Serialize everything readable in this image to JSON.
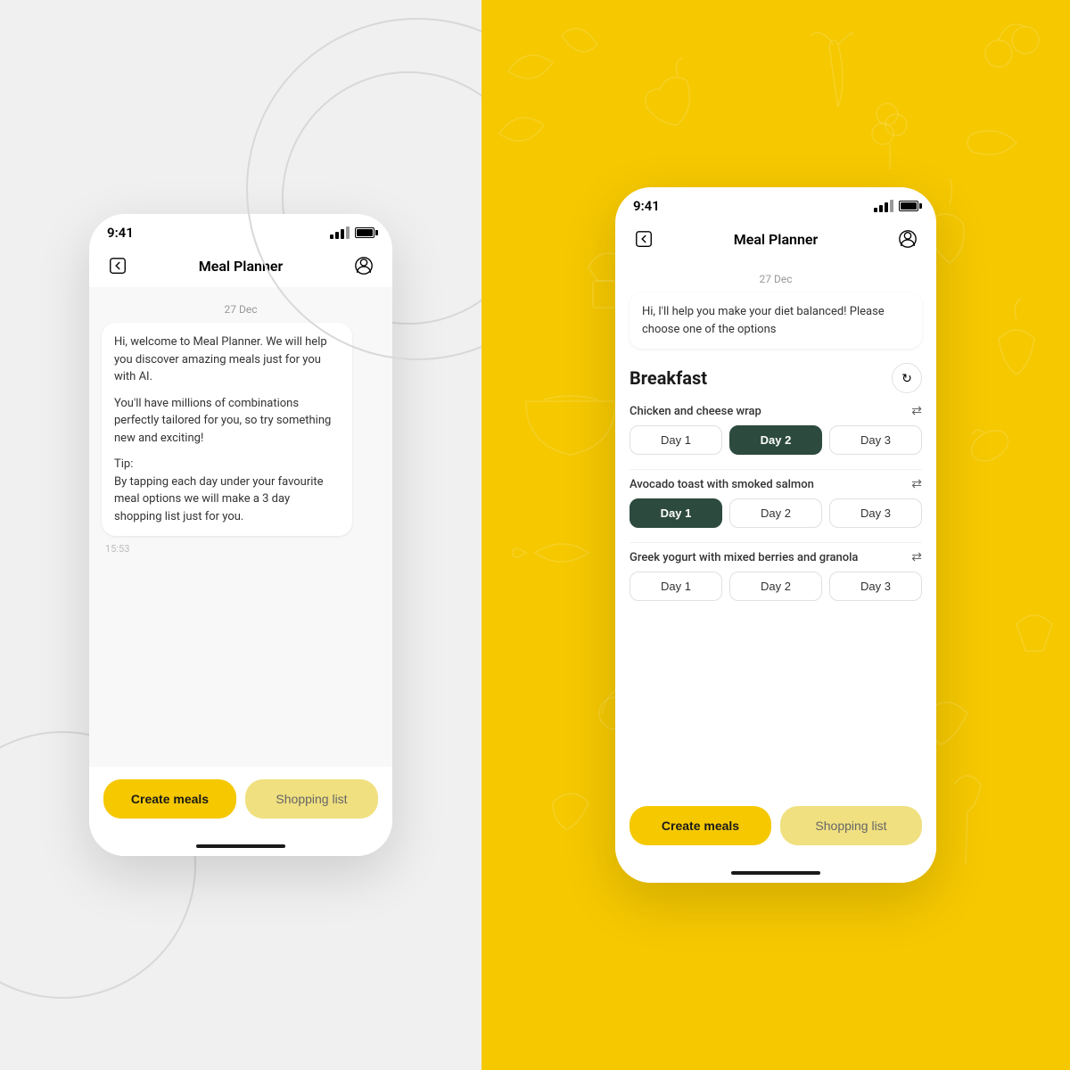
{
  "left": {
    "phone": {
      "status_bar": {
        "time": "9:41",
        "signal": "●●●",
        "battery": "■"
      },
      "nav": {
        "title": "Meal Planner"
      },
      "date_divider": "27 Dec",
      "chat_bubble": {
        "line1": "Hi, welcome to Meal Planner. We",
        "line2": "will help you discover amazing meals just for you",
        "line3": "with AI.",
        "line4": "You'll have millions of combinations perfectly",
        "line5": "tailored for you, so try something new and exciting!",
        "line6": "Tip:",
        "line7": "By tapping each day under your favourite meal",
        "line8": "options we will make a 3 day shopping list just for",
        "line9": "you."
      },
      "timestamp": "15:53",
      "btn_primary": "Create meals",
      "btn_secondary": "Shopping list"
    }
  },
  "right": {
    "phone": {
      "status_bar": {
        "time": "9:41",
        "signal": "●●●",
        "battery": "■"
      },
      "nav": {
        "title": "Meal Planner"
      },
      "date_divider": "27 Dec",
      "ai_message": "Hi, I'll help you make your diet balanced! Please choose one of the options",
      "section": {
        "title": "Breakfast",
        "meals": [
          {
            "name": "Chicken and cheese wrap",
            "days": [
              "Day 1",
              "Day 2",
              "Day 3"
            ],
            "active_day": 1
          },
          {
            "name": "Avocado toast with smoked salmon",
            "days": [
              "Day 1",
              "Day 2",
              "Day 3"
            ],
            "active_day": 0
          },
          {
            "name": "Greek yogurt with mixed berries and granola",
            "days": [
              "Day 1",
              "Day 2",
              "Day 3"
            ],
            "active_day": -1
          }
        ]
      },
      "btn_primary": "Create meals",
      "btn_secondary": "Shopping list"
    }
  }
}
